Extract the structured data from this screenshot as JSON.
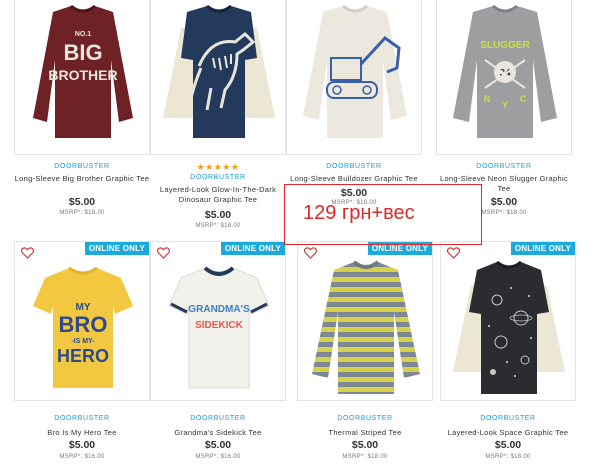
{
  "products": [
    {
      "label": "DOORBUSTER",
      "name": "Long-Sleeve Big Brother Graphic Tee",
      "price": "$5.00",
      "msrp": "MSRP*: $18.00",
      "badge": "",
      "stars": ""
    },
    {
      "label": "DOORBUSTER",
      "name": "Layered-Look Glow-In-The-Dark Dinosaur Graphic Tee",
      "price": "$5.00",
      "msrp": "MSRP*: $18.00",
      "badge": "",
      "stars": "★★★★★"
    },
    {
      "label": "DOORBUSTER",
      "name": "Long-Sleeve Bulldozer Graphic Tee",
      "price": "$5.00",
      "msrp": "MSRP*: $18.00",
      "badge": "",
      "stars": ""
    },
    {
      "label": "DOORBUSTER",
      "name": "Long-Sleeve Neon Slugger Graphic Tee",
      "price": "$5.00",
      "msrp": "MSRP*: $18.00",
      "badge": "",
      "stars": ""
    },
    {
      "label": "DOORBUSTER",
      "name": "Bro Is My Hero Tee",
      "price": "$5.00",
      "msrp": "MSRP*: $16.00",
      "badge": "ONLINE ONLY",
      "stars": ""
    },
    {
      "label": "DOORBUSTER",
      "name": "Grandma's Sidekick Tee",
      "price": "$5.00",
      "msrp": "MSRP*: $16.00",
      "badge": "ONLINE ONLY",
      "stars": ""
    },
    {
      "label": "DOORBUSTER",
      "name": "Thermal Striped Tee",
      "price": "$5.00",
      "msrp": "MSRP*: $18.00",
      "badge": "ONLINE ONLY",
      "stars": ""
    },
    {
      "label": "DOORBUSTER",
      "name": "Layered-Look Space Graphic Tee",
      "price": "$5.00",
      "msrp": "MSRP*: $18.00",
      "badge": "ONLINE ONLY",
      "stars": ""
    }
  ],
  "graphics": {
    "p0": [
      "NO.1",
      "BIG",
      "BROTHER"
    ],
    "p3": [
      "SLUGGER",
      "34",
      "N",
      "Y",
      "C"
    ],
    "p4": [
      "MY",
      "BRO",
      "-IS MY-",
      "HERO"
    ],
    "p5": [
      "GRANDMA'S",
      "SIDEKICK"
    ]
  },
  "annotation": {
    "text": "129 грн+вес"
  },
  "colors": {
    "accent": "#1aa0d6",
    "badge": "#1baad9",
    "annotation": "#e02828",
    "stars": "#f29b1a"
  }
}
